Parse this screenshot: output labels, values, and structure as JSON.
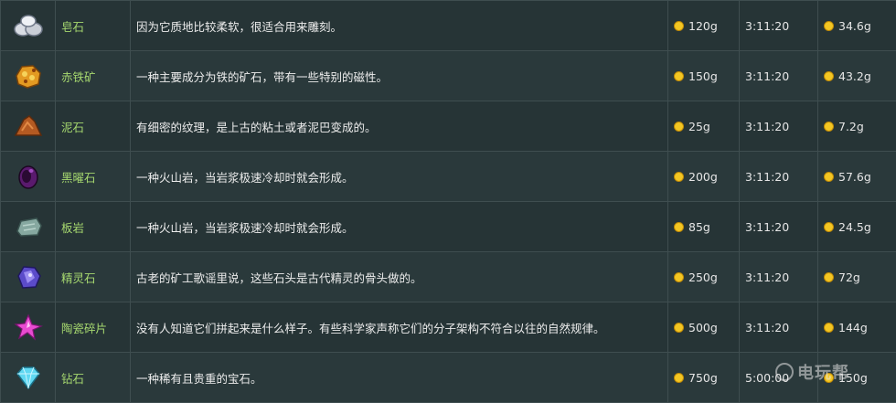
{
  "rows": [
    {
      "icon": "limestone-icon",
      "name": "皂石",
      "desc": "因为它质地比较柔软，很适合用来雕刻。",
      "price": "120g",
      "time": "3:11:20",
      "value": "34.6g"
    },
    {
      "icon": "hematite-icon",
      "name": "赤铁矿",
      "desc": "一种主要成分为铁的矿石，带有一些特别的磁性。",
      "price": "150g",
      "time": "3:11:20",
      "value": "43.2g"
    },
    {
      "icon": "mudstone-icon",
      "name": "泥石",
      "desc": "有细密的纹理，是上古的粘土或者泥巴变成的。",
      "price": "25g",
      "time": "3:11:20",
      "value": "7.2g"
    },
    {
      "icon": "obsidian-icon",
      "name": "黑曜石",
      "desc": "一种火山岩，当岩浆极速冷却时就会形成。",
      "price": "200g",
      "time": "3:11:20",
      "value": "57.6g"
    },
    {
      "icon": "slate-icon",
      "name": "板岩",
      "desc": "一种火山岩，当岩浆极速冷却时就会形成。",
      "price": "85g",
      "time": "3:11:20",
      "value": "24.5g"
    },
    {
      "icon": "fairy-stone-icon",
      "name": "精灵石",
      "desc": "古老的矿工歌谣里说，这些石头是古代精灵的骨头做的。",
      "price": "250g",
      "time": "3:11:20",
      "value": "72g"
    },
    {
      "icon": "prismatic-shard-icon",
      "name": "陶瓷碎片",
      "desc": "没有人知道它们拼起来是什么样子。有些科学家声称它们的分子架构不符合以往的自然规律。",
      "price": "500g",
      "time": "3:11:20",
      "value": "144g"
    },
    {
      "icon": "diamond-icon",
      "name": "钻石",
      "desc": "一种稀有且贵重的宝石。",
      "price": "750g",
      "time": "5:00:00",
      "value": "150g"
    }
  ],
  "watermark": "电玩帮"
}
